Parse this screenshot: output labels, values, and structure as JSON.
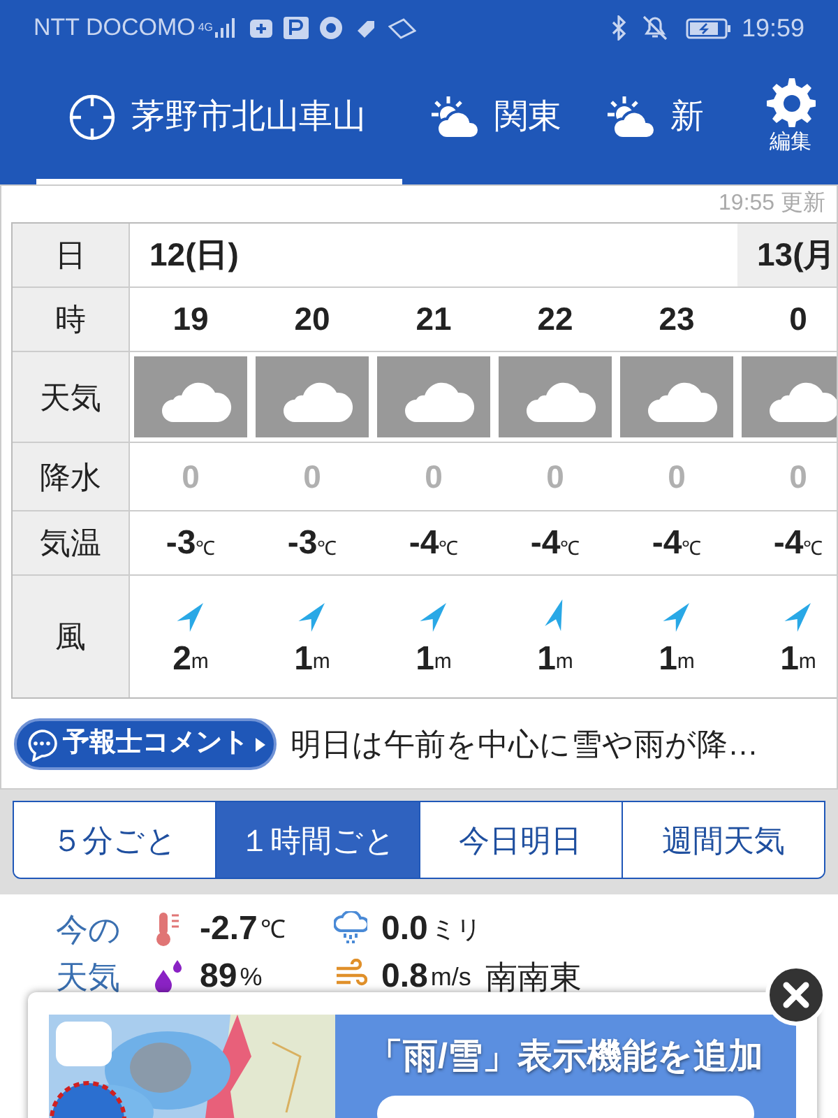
{
  "status_bar": {
    "carrier": "NTT DOCOMO",
    "network": "4G",
    "time": "19:59"
  },
  "location_tabs": [
    {
      "label": "茅野市北山車山",
      "kind": "location",
      "selected": true
    },
    {
      "label": "関東",
      "kind": "area",
      "selected": false
    },
    {
      "label": "新",
      "kind": "area",
      "selected": false
    }
  ],
  "settings_button": {
    "label": "編集"
  },
  "forecast": {
    "updated": "19:55 更新",
    "row_labels": [
      "日",
      "時",
      "天気",
      "降水",
      "気温",
      "風"
    ],
    "days": [
      {
        "label": "12(日)",
        "selected": true,
        "hours": [
          {
            "hour": "19",
            "kind": "cloudy",
            "precip": "0",
            "temp": "-3",
            "temp_unit": "℃",
            "wind": {
              "kind": "ne",
              "speed": "2",
              "unit": "m"
            }
          },
          {
            "hour": "20",
            "kind": "cloudy",
            "precip": "0",
            "temp": "-3",
            "temp_unit": "℃",
            "wind": {
              "kind": "ne",
              "speed": "1",
              "unit": "m"
            }
          },
          {
            "hour": "21",
            "kind": "cloudy",
            "precip": "0",
            "temp": "-4",
            "temp_unit": "℃",
            "wind": {
              "kind": "ne",
              "speed": "1",
              "unit": "m"
            }
          },
          {
            "hour": "22",
            "kind": "cloudy",
            "precip": "0",
            "temp": "-4",
            "temp_unit": "℃",
            "wind": {
              "kind": "nne",
              "speed": "1",
              "unit": "m"
            }
          },
          {
            "hour": "23",
            "kind": "cloudy",
            "precip": "0",
            "temp": "-4",
            "temp_unit": "℃",
            "wind": {
              "kind": "ne",
              "speed": "1",
              "unit": "m"
            }
          }
        ]
      },
      {
        "label": "13(月",
        "selected": false,
        "hours": [
          {
            "hour": "0",
            "kind": "cloudy",
            "precip": "0",
            "temp": "-4",
            "temp_unit": "℃",
            "wind": {
              "kind": "ne",
              "speed": "1",
              "unit": "m"
            }
          }
        ]
      }
    ]
  },
  "comment": {
    "button": "予報士コメント",
    "text": "明日は午前を中心に雪や雨が降…"
  },
  "view_tabs": [
    {
      "label": "５分ごと",
      "selected": false
    },
    {
      "label": "１時間ごと",
      "selected": true
    },
    {
      "label": "今日明日",
      "selected": false
    },
    {
      "label": "週間天気",
      "selected": false
    }
  ],
  "current": {
    "title": [
      "今の",
      "天気"
    ],
    "items": [
      {
        "kind": "temperature",
        "value": "-2.7",
        "unit": "℃"
      },
      {
        "kind": "rain",
        "value": "0.0",
        "unit": "ミリ"
      },
      {
        "kind": "humidity",
        "value": "89",
        "unit": "%"
      },
      {
        "kind": "wind",
        "value": "0.8",
        "unit": "m/s",
        "direction": "南南東"
      }
    ]
  },
  "ad": {
    "headline": "「雨/雪」表示機能を追加"
  }
}
